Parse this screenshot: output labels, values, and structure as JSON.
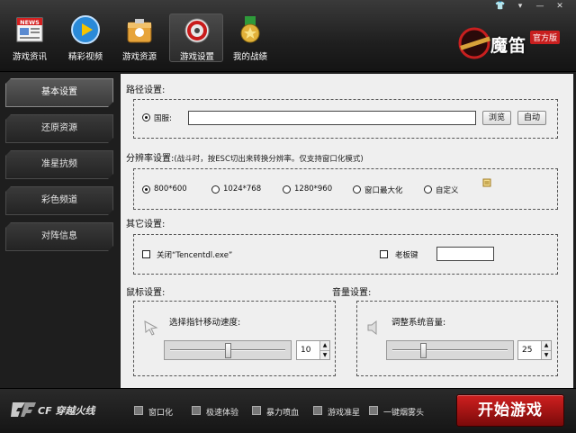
{
  "nav": {
    "items": [
      {
        "label": "游戏资讯",
        "icon": "news-icon"
      },
      {
        "label": "精彩视频",
        "icon": "play-icon"
      },
      {
        "label": "游戏资源",
        "icon": "box-icon"
      },
      {
        "label": "游戏设置",
        "icon": "gear-icon"
      },
      {
        "label": "我的战绩",
        "icon": "medal-icon"
      }
    ],
    "news_badge": "NEWS"
  },
  "window_controls": {
    "shirt": "👕",
    "dropdown": "▾",
    "minimize": "—",
    "close": "✕"
  },
  "brand": {
    "name": "魔笛",
    "badge": "官方版"
  },
  "sidebar": {
    "items": [
      {
        "label": "基本设置"
      },
      {
        "label": "还原资源"
      },
      {
        "label": "准星抗频"
      },
      {
        "label": "彩色频道"
      },
      {
        "label": "对阵信息"
      }
    ]
  },
  "path_settings": {
    "title": "路径设置:",
    "radio_label": "国服:",
    "path_value": "",
    "browse_label": "浏览",
    "auto_label": "自动"
  },
  "resolution": {
    "title": "分辨率设置:",
    "note": "(战斗时，按ESC切出来转换分辨率。仅支持窗口化模式)",
    "options": [
      "800*600",
      "1024*768",
      "1280*960",
      "窗口最大化",
      "自定义"
    ],
    "selected": "800*600"
  },
  "other_settings": {
    "title": "其它设置:",
    "close_label": "关闭“Tencentdl.exe”",
    "boss_key_label": "老板键",
    "boss_key_value": ""
  },
  "mouse": {
    "title": "鼠标设置:",
    "label": "选择指针移动速度:",
    "value": "10",
    "slider_fraction": 0.5
  },
  "volume": {
    "title": "音量设置:",
    "label": "调整系统音量:",
    "value": "25",
    "slider_fraction": 0.26
  },
  "bottom": {
    "logo": "CF 穿越火线",
    "options": [
      "窗口化",
      "极速体验",
      "暴力喷血",
      "游戏准星",
      "一键烟雾头"
    ],
    "start_label": "开始游戏"
  },
  "colors": {
    "start_button": "#c0181a",
    "brand_badge": "#c81f1f",
    "content_bg": "#efefef",
    "chrome_dark": "#1c1c1c"
  }
}
